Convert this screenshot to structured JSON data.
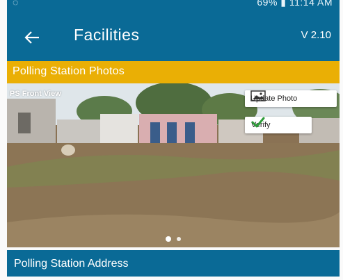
{
  "status_bar": {
    "left_icon": "whatsapp-icon",
    "right_text": "69% ▮ 11:14 AM"
  },
  "app_bar": {
    "back_icon": "back-arrow-icon",
    "title": "Facilities",
    "version": "V 2.10"
  },
  "photos_section": {
    "header": "Polling Station Photos",
    "caption": "PS Front View",
    "update_photo_label": "Update Photo",
    "update_photo_icon": "image-icon",
    "verify_label": "Verify",
    "verify_icon": "check-icon",
    "page_count": 2,
    "active_page": 1
  },
  "address_section": {
    "header": "Polling Station Address"
  },
  "colors": {
    "primary": "#0a6a96",
    "section_highlight": "#eaaf05",
    "verify_check": "#2e9c3a"
  }
}
